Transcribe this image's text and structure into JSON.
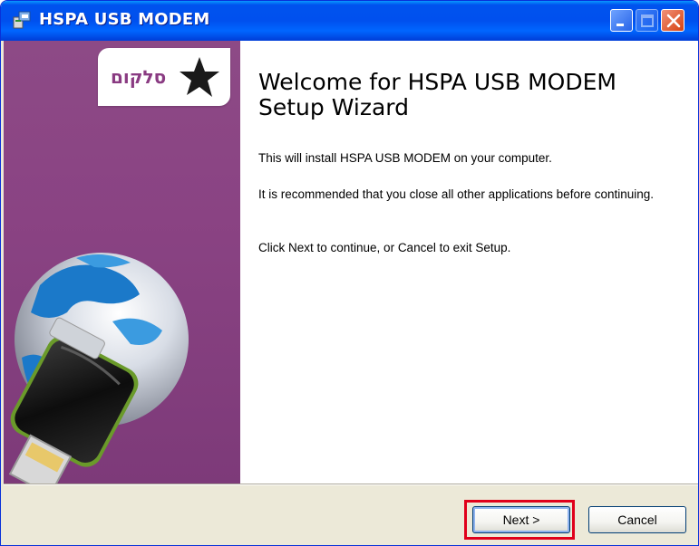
{
  "window": {
    "title": "HSPA USB MODEM"
  },
  "banner": {
    "logo_text": "סלקום"
  },
  "content": {
    "heading": "Welcome for HSPA USB MODEM Setup Wizard",
    "paragraphs": [
      "This will install HSPA USB MODEM on your computer.",
      "It is recommended that you close all other applications before continuing.",
      "Click Next to continue, or Cancel to exit Setup."
    ]
  },
  "buttons": {
    "next_label": "Next >",
    "cancel_label": "Cancel"
  },
  "colors": {
    "titlebar": "#0053ee",
    "banner": "#8a4383",
    "highlight": "#e0001b"
  }
}
